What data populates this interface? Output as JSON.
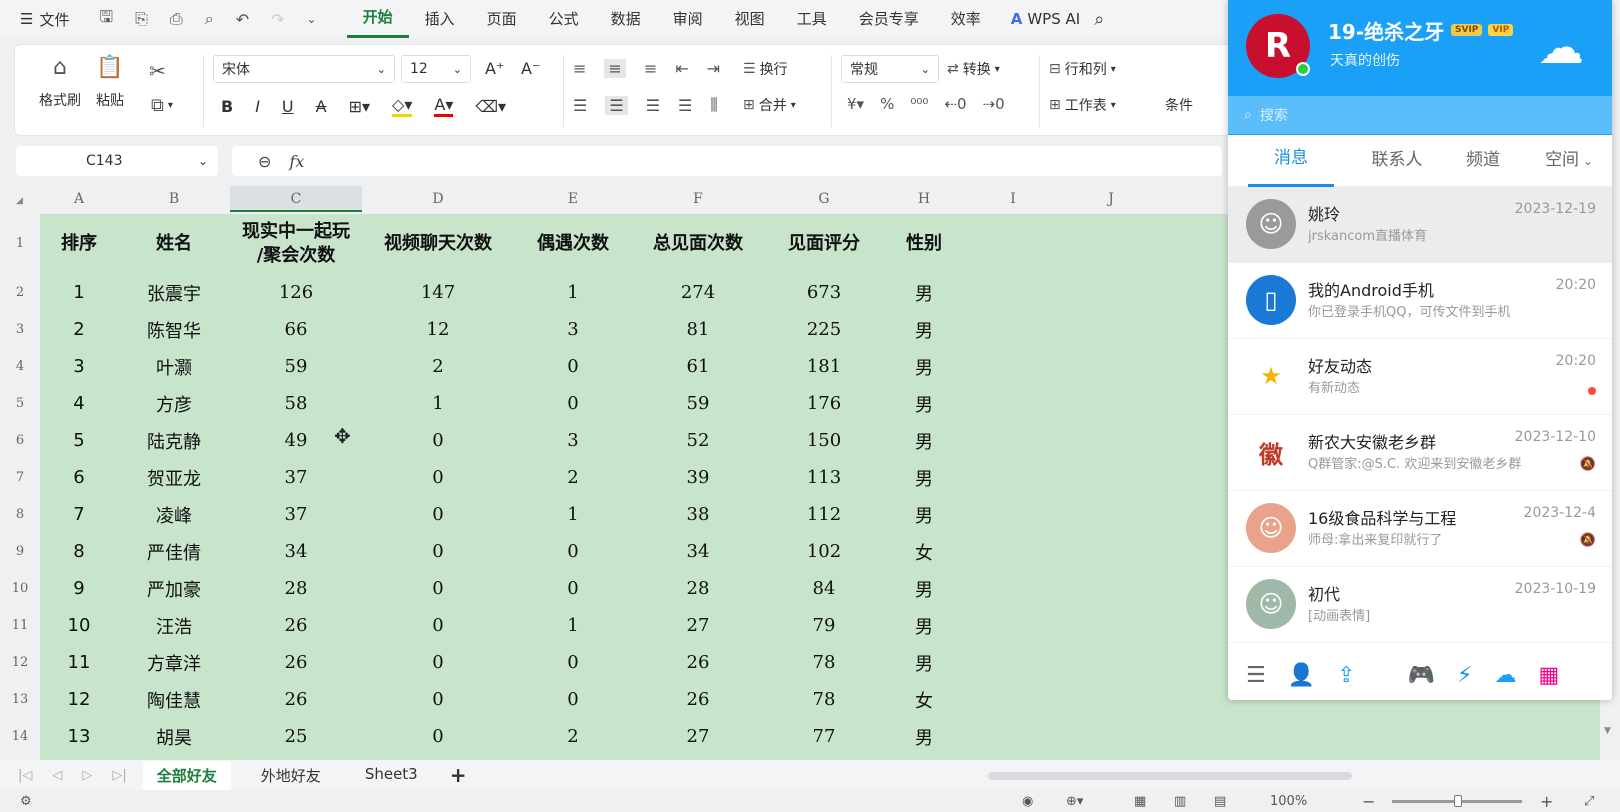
{
  "menu": {
    "file_label": "文件",
    "tabs": [
      "开始",
      "插入",
      "页面",
      "公式",
      "数据",
      "审阅",
      "视图",
      "工具",
      "会员专享",
      "效率"
    ],
    "active_tab": "开始",
    "wps_ai": "WPS AI"
  },
  "ribbon": {
    "format_painter": "格式刷",
    "paste": "粘贴",
    "font_name": "宋体",
    "font_size": "12",
    "wrap": "换行",
    "merge": "合并",
    "number_format": "常规",
    "convert": "转换",
    "row_col": "行和列",
    "worksheet": "工作表",
    "cond": "条件"
  },
  "formula_bar": {
    "cell_ref": "C143",
    "fx": "fx",
    "value": ""
  },
  "sheet": {
    "columns": [
      "A",
      "B",
      "C",
      "D",
      "E",
      "F",
      "G",
      "H",
      "I",
      "J"
    ],
    "selected_column": "C",
    "header_row": [
      "排序",
      "姓名",
      "现实中一起玩\n/聚会次数",
      "视频聊天次数",
      "偶遇次数",
      "总见面次数",
      "见面评分",
      "性别"
    ],
    "rows": [
      [
        "1",
        "张震宇",
        "126",
        "147",
        "1",
        "274",
        "673",
        "男"
      ],
      [
        "2",
        "陈智华",
        "66",
        "12",
        "3",
        "81",
        "225",
        "男"
      ],
      [
        "3",
        "叶灏",
        "59",
        "2",
        "0",
        "61",
        "181",
        "男"
      ],
      [
        "4",
        "方彦",
        "58",
        "1",
        "0",
        "59",
        "176",
        "男"
      ],
      [
        "5",
        "陆克静",
        "49",
        "0",
        "3",
        "52",
        "150",
        "男"
      ],
      [
        "6",
        "贺亚龙",
        "37",
        "0",
        "2",
        "39",
        "113",
        "男"
      ],
      [
        "7",
        "凌峰",
        "37",
        "0",
        "1",
        "38",
        "112",
        "男"
      ],
      [
        "8",
        "严佳倩",
        "34",
        "0",
        "0",
        "34",
        "102",
        "女"
      ],
      [
        "9",
        "严加豪",
        "28",
        "0",
        "0",
        "28",
        "84",
        "男"
      ],
      [
        "10",
        "汪浩",
        "26",
        "0",
        "1",
        "27",
        "79",
        "男"
      ],
      [
        "11",
        "方章洋",
        "26",
        "0",
        "0",
        "26",
        "78",
        "男"
      ],
      [
        "12",
        "陶佳慧",
        "26",
        "0",
        "0",
        "26",
        "78",
        "女"
      ],
      [
        "13",
        "胡昊",
        "25",
        "0",
        "2",
        "27",
        "77",
        "男"
      ]
    ],
    "row_numbers": [
      "1",
      "2",
      "3",
      "4",
      "5",
      "6",
      "7",
      "8",
      "9",
      "10",
      "11",
      "12",
      "13",
      "14"
    ],
    "tabs": [
      "全部好友",
      "外地好友",
      "Sheet3"
    ],
    "active_tab": "全部好友"
  },
  "status": {
    "zoom": "100%"
  },
  "qq": {
    "nickname": "19-绝杀之牙",
    "badge1": "SVIP",
    "badge2": "VIP",
    "signature": "天真的创伤",
    "search_placeholder": "搜索",
    "tabs": [
      "消息",
      "联系人",
      "频道",
      "空间"
    ],
    "active_tab": "消息",
    "conversations": [
      {
        "name": "姚玲",
        "time": "2023-12-19",
        "msg": "jrskancom直播体育"
      },
      {
        "name": "我的Android手机",
        "time": "20:20",
        "msg": "你已登录手机QQ，可传文件到手机"
      },
      {
        "name": "好友动态",
        "time": "20:20",
        "msg": "有新动态"
      },
      {
        "name": "新农大安徽老乡群",
        "time": "2023-12-10",
        "msg": "Q群管家:@S.C. 欢迎来到安徽老乡群"
      },
      {
        "name": "16级食品科学与工程",
        "time": "2023-12-4",
        "msg": "师母:拿出来复印就行了"
      },
      {
        "name": "初代",
        "time": "2023-10-19",
        "msg": "[动画表情]"
      }
    ]
  }
}
